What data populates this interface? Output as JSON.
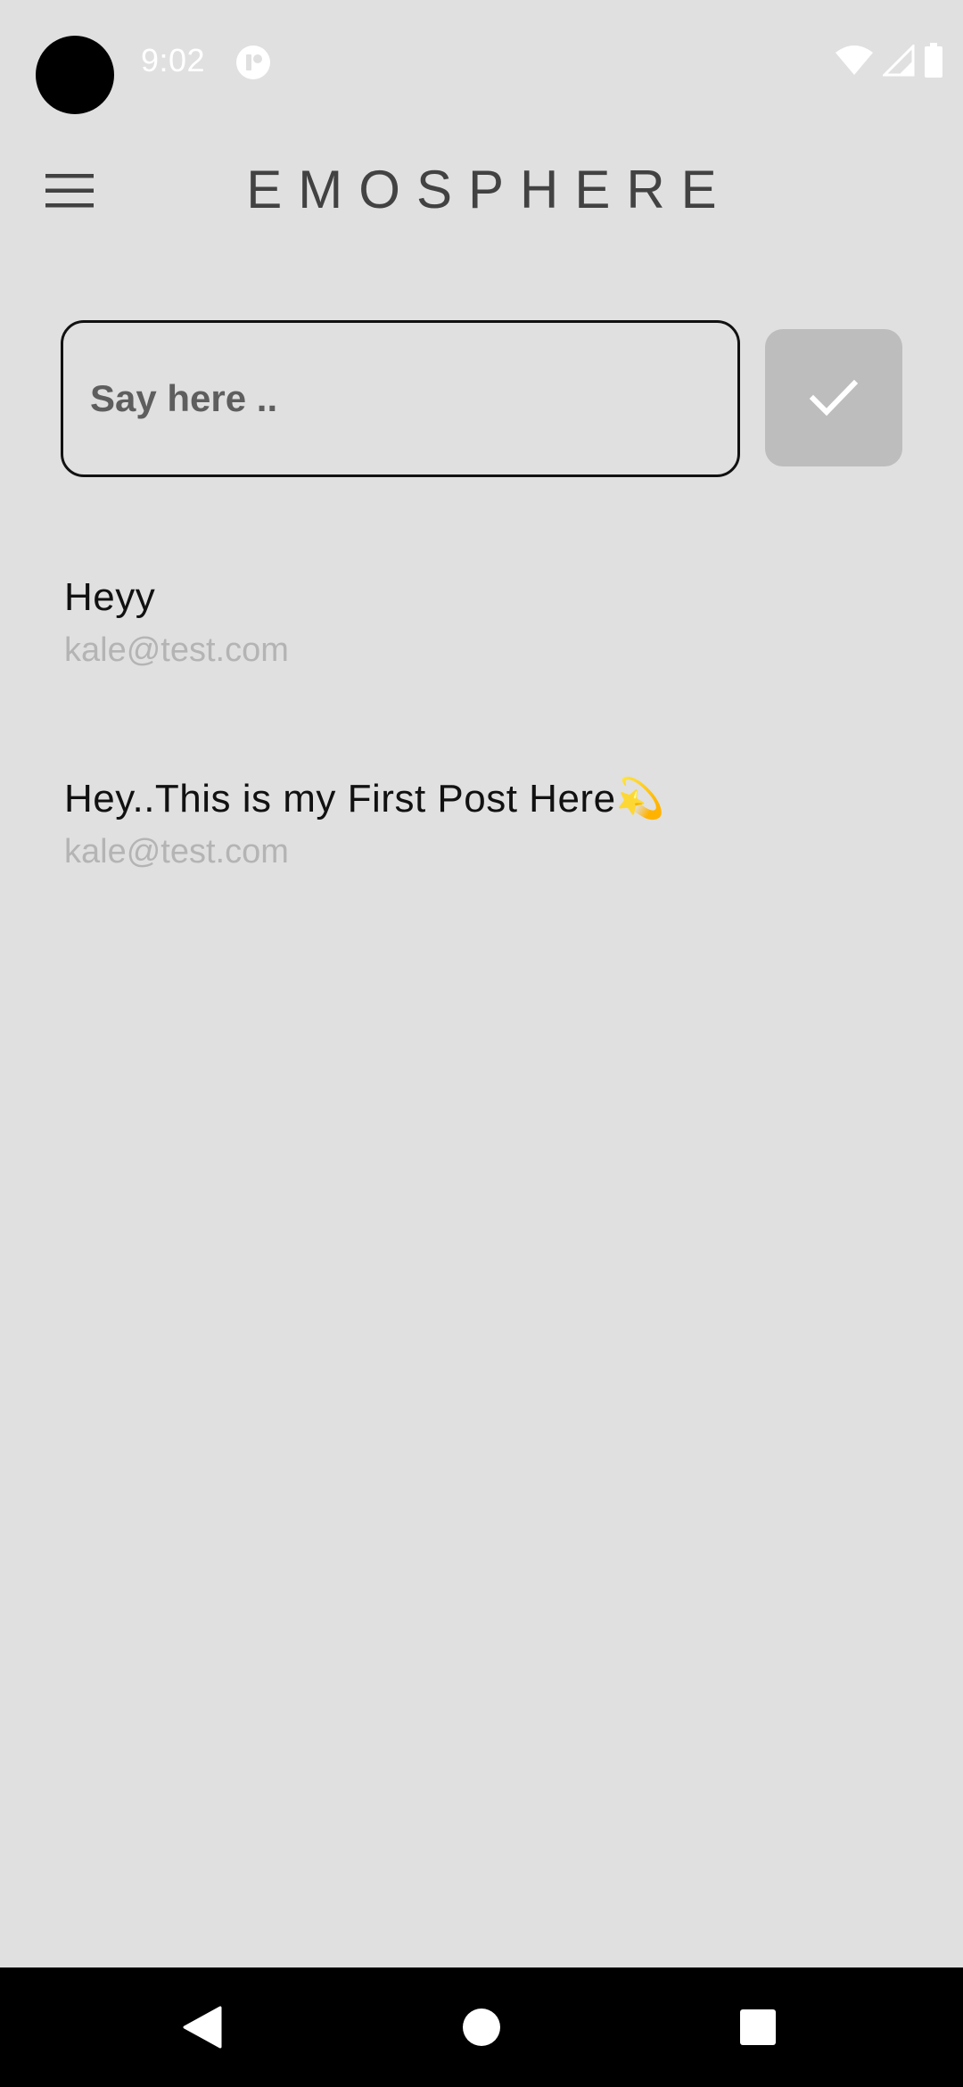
{
  "status_bar": {
    "time": "9:02",
    "icons": [
      "camera-cutout",
      "app-notification-icon",
      "wifi-icon",
      "cellular-signal-icon",
      "battery-icon"
    ]
  },
  "app_bar": {
    "title": "EMOSPHERE",
    "menu_icon": "hamburger-menu-icon"
  },
  "composer": {
    "placeholder": "Say here ..",
    "value": "",
    "submit_icon": "checkmark-icon"
  },
  "posts": [
    {
      "text": "Heyy",
      "author": "kale@test.com"
    },
    {
      "text": "Hey..This is my First Post Here💫",
      "author": "kale@test.com"
    }
  ],
  "nav_bar": {
    "icons": [
      "back-icon",
      "home-icon",
      "recents-icon"
    ]
  },
  "colors": {
    "background": "#e0e0e0",
    "title": "#424242",
    "send_button": "#bdbdbd",
    "author_text": "#b4b4b4",
    "nav_bar": "#000000"
  }
}
